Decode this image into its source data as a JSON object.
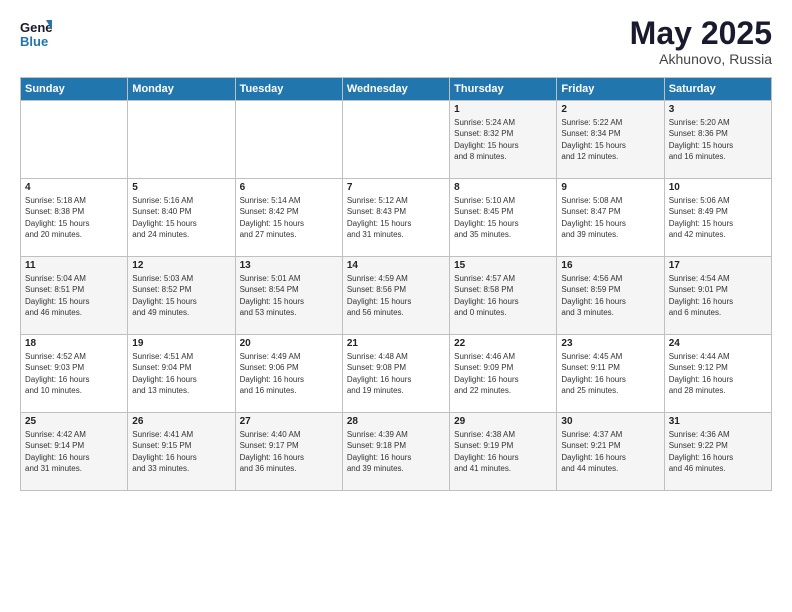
{
  "header": {
    "logo_line1": "General",
    "logo_line2": "Blue",
    "month": "May 2025",
    "location": "Akhunovo, Russia"
  },
  "days_of_week": [
    "Sunday",
    "Monday",
    "Tuesday",
    "Wednesday",
    "Thursday",
    "Friday",
    "Saturday"
  ],
  "weeks": [
    [
      {
        "day": "",
        "content": ""
      },
      {
        "day": "",
        "content": ""
      },
      {
        "day": "",
        "content": ""
      },
      {
        "day": "",
        "content": ""
      },
      {
        "day": "1",
        "content": "Sunrise: 5:24 AM\nSunset: 8:32 PM\nDaylight: 15 hours\nand 8 minutes."
      },
      {
        "day": "2",
        "content": "Sunrise: 5:22 AM\nSunset: 8:34 PM\nDaylight: 15 hours\nand 12 minutes."
      },
      {
        "day": "3",
        "content": "Sunrise: 5:20 AM\nSunset: 8:36 PM\nDaylight: 15 hours\nand 16 minutes."
      }
    ],
    [
      {
        "day": "4",
        "content": "Sunrise: 5:18 AM\nSunset: 8:38 PM\nDaylight: 15 hours\nand 20 minutes."
      },
      {
        "day": "5",
        "content": "Sunrise: 5:16 AM\nSunset: 8:40 PM\nDaylight: 15 hours\nand 24 minutes."
      },
      {
        "day": "6",
        "content": "Sunrise: 5:14 AM\nSunset: 8:42 PM\nDaylight: 15 hours\nand 27 minutes."
      },
      {
        "day": "7",
        "content": "Sunrise: 5:12 AM\nSunset: 8:43 PM\nDaylight: 15 hours\nand 31 minutes."
      },
      {
        "day": "8",
        "content": "Sunrise: 5:10 AM\nSunset: 8:45 PM\nDaylight: 15 hours\nand 35 minutes."
      },
      {
        "day": "9",
        "content": "Sunrise: 5:08 AM\nSunset: 8:47 PM\nDaylight: 15 hours\nand 39 minutes."
      },
      {
        "day": "10",
        "content": "Sunrise: 5:06 AM\nSunset: 8:49 PM\nDaylight: 15 hours\nand 42 minutes."
      }
    ],
    [
      {
        "day": "11",
        "content": "Sunrise: 5:04 AM\nSunset: 8:51 PM\nDaylight: 15 hours\nand 46 minutes."
      },
      {
        "day": "12",
        "content": "Sunrise: 5:03 AM\nSunset: 8:52 PM\nDaylight: 15 hours\nand 49 minutes."
      },
      {
        "day": "13",
        "content": "Sunrise: 5:01 AM\nSunset: 8:54 PM\nDaylight: 15 hours\nand 53 minutes."
      },
      {
        "day": "14",
        "content": "Sunrise: 4:59 AM\nSunset: 8:56 PM\nDaylight: 15 hours\nand 56 minutes."
      },
      {
        "day": "15",
        "content": "Sunrise: 4:57 AM\nSunset: 8:58 PM\nDaylight: 16 hours\nand 0 minutes."
      },
      {
        "day": "16",
        "content": "Sunrise: 4:56 AM\nSunset: 8:59 PM\nDaylight: 16 hours\nand 3 minutes."
      },
      {
        "day": "17",
        "content": "Sunrise: 4:54 AM\nSunset: 9:01 PM\nDaylight: 16 hours\nand 6 minutes."
      }
    ],
    [
      {
        "day": "18",
        "content": "Sunrise: 4:52 AM\nSunset: 9:03 PM\nDaylight: 16 hours\nand 10 minutes."
      },
      {
        "day": "19",
        "content": "Sunrise: 4:51 AM\nSunset: 9:04 PM\nDaylight: 16 hours\nand 13 minutes."
      },
      {
        "day": "20",
        "content": "Sunrise: 4:49 AM\nSunset: 9:06 PM\nDaylight: 16 hours\nand 16 minutes."
      },
      {
        "day": "21",
        "content": "Sunrise: 4:48 AM\nSunset: 9:08 PM\nDaylight: 16 hours\nand 19 minutes."
      },
      {
        "day": "22",
        "content": "Sunrise: 4:46 AM\nSunset: 9:09 PM\nDaylight: 16 hours\nand 22 minutes."
      },
      {
        "day": "23",
        "content": "Sunrise: 4:45 AM\nSunset: 9:11 PM\nDaylight: 16 hours\nand 25 minutes."
      },
      {
        "day": "24",
        "content": "Sunrise: 4:44 AM\nSunset: 9:12 PM\nDaylight: 16 hours\nand 28 minutes."
      }
    ],
    [
      {
        "day": "25",
        "content": "Sunrise: 4:42 AM\nSunset: 9:14 PM\nDaylight: 16 hours\nand 31 minutes."
      },
      {
        "day": "26",
        "content": "Sunrise: 4:41 AM\nSunset: 9:15 PM\nDaylight: 16 hours\nand 33 minutes."
      },
      {
        "day": "27",
        "content": "Sunrise: 4:40 AM\nSunset: 9:17 PM\nDaylight: 16 hours\nand 36 minutes."
      },
      {
        "day": "28",
        "content": "Sunrise: 4:39 AM\nSunset: 9:18 PM\nDaylight: 16 hours\nand 39 minutes."
      },
      {
        "day": "29",
        "content": "Sunrise: 4:38 AM\nSunset: 9:19 PM\nDaylight: 16 hours\nand 41 minutes."
      },
      {
        "day": "30",
        "content": "Sunrise: 4:37 AM\nSunset: 9:21 PM\nDaylight: 16 hours\nand 44 minutes."
      },
      {
        "day": "31",
        "content": "Sunrise: 4:36 AM\nSunset: 9:22 PM\nDaylight: 16 hours\nand 46 minutes."
      }
    ]
  ]
}
